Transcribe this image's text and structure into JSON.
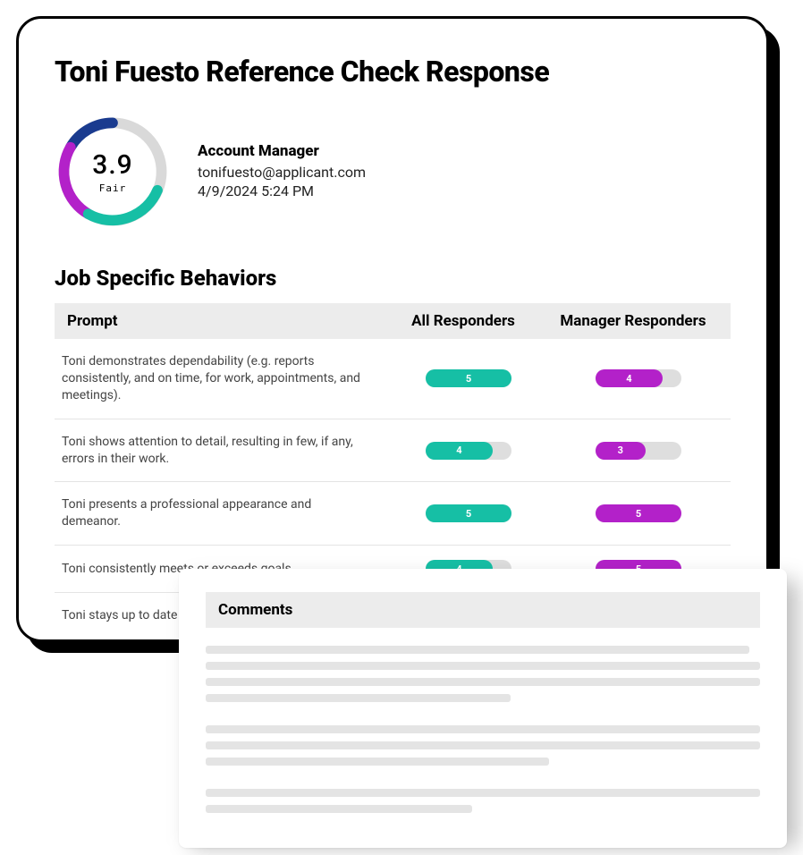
{
  "title": "Toni Fuesto Reference Check Response",
  "gauge": {
    "score": "3.9",
    "label": "Fair"
  },
  "meta": {
    "role": "Account Manager",
    "email": "tonifuesto@applicant.com",
    "datetime": "4/9/2024  5:24 PM"
  },
  "section_title": "Job Specific Behaviors",
  "table": {
    "headers": {
      "prompt": "Prompt",
      "all": "All Responders",
      "mgr": "Manager Responders"
    },
    "rows": [
      {
        "prompt": "Toni demonstrates dependability (e.g. reports consistently, and on time, for work, appointments, and meetings).",
        "all": {
          "value": "5",
          "pct": 100
        },
        "mgr": {
          "value": "4",
          "pct": 78
        }
      },
      {
        "prompt": "Toni shows attention to detail, resulting in few, if any, errors in their work.",
        "all": {
          "value": "4",
          "pct": 78
        },
        "mgr": {
          "value": "3",
          "pct": 58
        }
      },
      {
        "prompt": "Toni presents a professional appearance and demeanor.",
        "all": {
          "value": "5",
          "pct": 100
        },
        "mgr": {
          "value": "5",
          "pct": 100
        }
      },
      {
        "prompt": "Toni consistently meets or exceeds goals.",
        "all": {
          "value": "4",
          "pct": 78
        },
        "mgr": {
          "value": "5",
          "pct": 100
        }
      },
      {
        "prompt": "Toni stays up to date on c",
        "all": {
          "value": "",
          "pct": 0
        },
        "mgr": {
          "value": "",
          "pct": 0
        }
      }
    ]
  },
  "comments": {
    "title": "Comments"
  }
}
